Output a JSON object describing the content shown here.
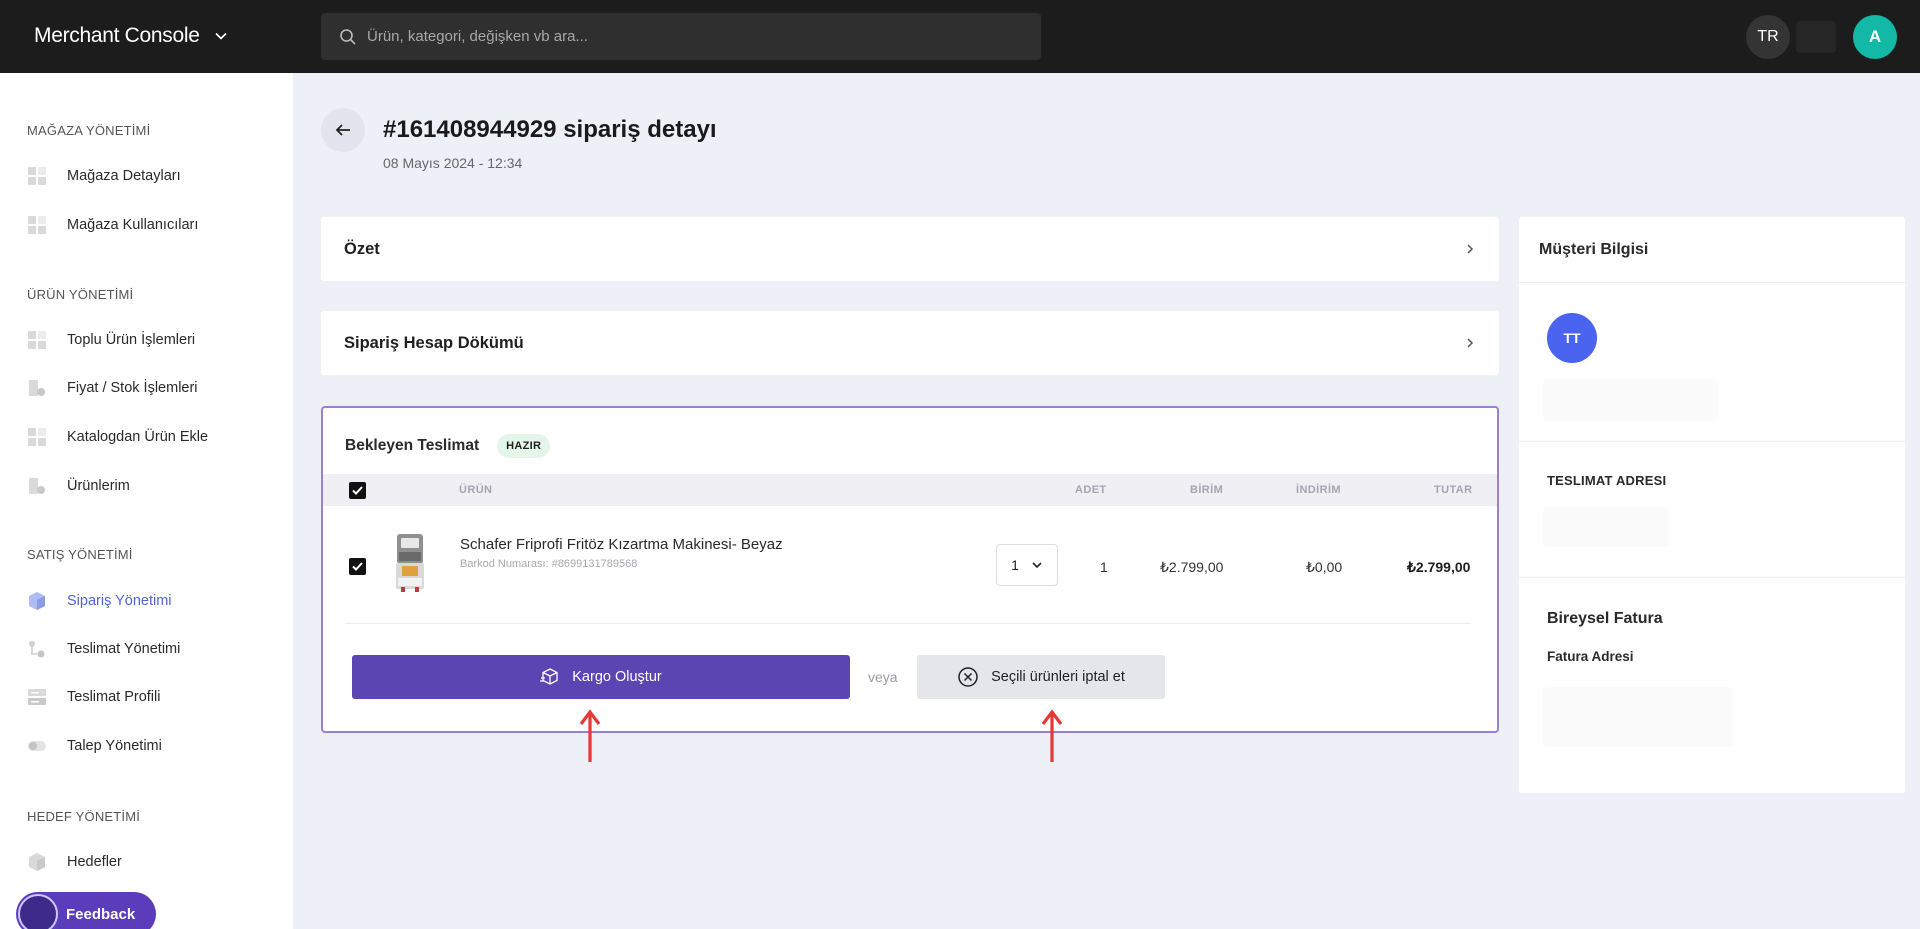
{
  "topbar": {
    "brand": "Merchant Console",
    "search_placeholder": "Ürün, kategori, değişken vb ara...",
    "lang": "TR",
    "avatar_initial": "A"
  },
  "sidebar": {
    "sections": [
      {
        "title": "MAĞAZA YÖNETİMİ",
        "items": [
          {
            "label": "Mağaza Detayları",
            "icon": "grid-icon"
          },
          {
            "label": "Mağaza Kullanıcıları",
            "icon": "grid-icon"
          }
        ]
      },
      {
        "title": "ÜRÜN YÖNETİMİ",
        "items": [
          {
            "label": "Toplu Ürün İşlemleri",
            "icon": "grid-icon"
          },
          {
            "label": "Fiyat / Stok İşlemleri",
            "icon": "tag-icon"
          },
          {
            "label": "Katalogdan Ürün Ekle",
            "icon": "grid-icon"
          },
          {
            "label": "Ürünlerim",
            "icon": "tag-icon"
          }
        ]
      },
      {
        "title": "SATIŞ YÖNETİMİ",
        "items": [
          {
            "label": "Sipariş Yönetimi",
            "icon": "box-icon",
            "active": true
          },
          {
            "label": "Teslimat Yönetimi",
            "icon": "route-icon"
          },
          {
            "label": "Teslimat Profili",
            "icon": "server-icon"
          },
          {
            "label": "Talep Yönetimi",
            "icon": "toggle-icon"
          }
        ]
      },
      {
        "title": "HEDEF YÖNETİMİ",
        "items": [
          {
            "label": "Hedefler",
            "icon": "hexagon-icon"
          }
        ]
      }
    ]
  },
  "feedback_label": "Feedback",
  "page": {
    "title": "#161408944929 sipariş detayı",
    "date": "08 Mayıs 2024 - 12:34"
  },
  "summary_label": "Özet",
  "account_label": "Sipariş Hesap Dökümü",
  "delivery": {
    "title": "Bekleyen Teslimat",
    "badge": "HAZIR",
    "columns": {
      "product": "ÜRÜN",
      "qty": "ADET",
      "unit": "BİRİM",
      "discount": "İNDİRİM",
      "total": "TUTAR"
    },
    "item": {
      "name": "Schafer Friprofi Fritöz Kızartma Makinesi- Beyaz",
      "barcode": "Barkod Numarası: #8699131789568",
      "select_qty": "1",
      "qty": "1",
      "unit": "₺2.799,00",
      "discount": "₺0,00",
      "total": "₺2.799,00"
    },
    "create_shipment": "Kargo Oluştur",
    "or": "veya",
    "cancel_selected": "Seçili ürünleri iptal et"
  },
  "customer": {
    "title": "Müşteri Bilgisi",
    "initials": "TT",
    "address_label": "TESLIMAT ADRESI",
    "invoice_title": "Bireysel Fatura",
    "invoice_address_label": "Fatura Adresi"
  },
  "colors": {
    "primary": "#5b45b3",
    "topbar": "#1c1c1c",
    "accent_teal": "#14b8a6",
    "avatar_blue": "#4a64f0",
    "arrow_red": "#e53935"
  }
}
